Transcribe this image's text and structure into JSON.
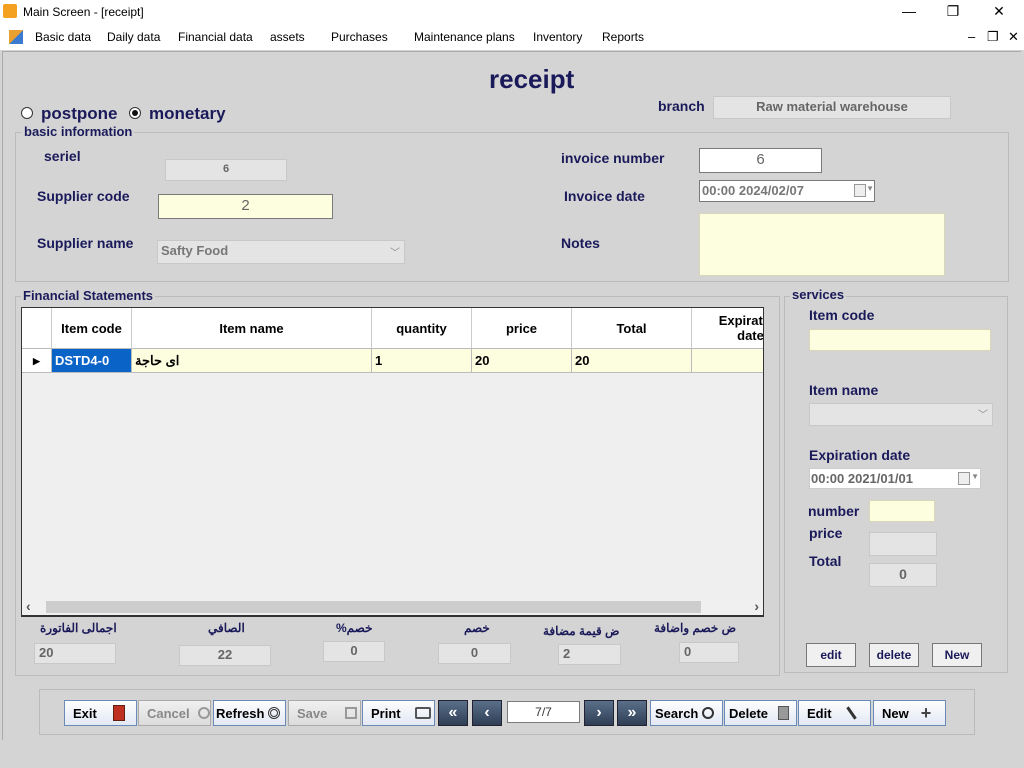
{
  "window": {
    "title": "Main Screen - [receipt]",
    "minimize": "—",
    "maximize": "❐",
    "close": "✕"
  },
  "menu": {
    "items": [
      "Basic data",
      "Daily data",
      "Financial data",
      "assets",
      "Purchases",
      "Maintenance plans",
      "Inventory",
      "Reports"
    ],
    "mdi_minimize": "–",
    "mdi_restore": "❐",
    "mdi_close": "✕"
  },
  "form": {
    "heading": "receipt",
    "payment_options": [
      "postpone",
      "monetary"
    ],
    "selected_payment": "monetary",
    "branch_label": "branch",
    "branch_value": "Raw material warehouse",
    "basic_info_title": "basic information",
    "serial_label": "seriel",
    "serial_value": "6",
    "supplier_code_label": "Supplier code",
    "supplier_code_value": "2",
    "supplier_name_label": "Supplier name",
    "supplier_name_value": "Safty Food",
    "invoice_number_label": "invoice number",
    "invoice_number_value": "6",
    "invoice_date_label": "Invoice date",
    "invoice_date_value": "00:00 2024/02/07",
    "notes_label": "Notes",
    "notes_value": ""
  },
  "grid": {
    "title": "Financial Statements",
    "columns": [
      "Item code",
      "Item name",
      "quantity",
      "price",
      "Total",
      "Expiration date"
    ],
    "rows": [
      {
        "item_code": "DSTD4-0",
        "item_name": "اى حاجة",
        "quantity": "1",
        "price": "20",
        "total": "20",
        "expiration": ""
      }
    ],
    "row_indicator": "▶",
    "scroll_left": "‹",
    "scroll_right": "›"
  },
  "services": {
    "title": "services",
    "item_code_label": "Item code",
    "item_code_value": "",
    "item_name_label": "Item name",
    "item_name_value": "",
    "expiration_label": "Expiration date",
    "expiration_value": "00:00 2021/01/01",
    "number_label": "number",
    "number_value": "",
    "price_label": "price",
    "price_value": "",
    "total_label": "Total",
    "total_value": "0",
    "edit_button": "edit",
    "delete_button": "delete",
    "new_button": "New"
  },
  "summary": {
    "invoice_total_label": "اجمالى الفاتورة",
    "invoice_total_value": "20",
    "net_label": "الصافي",
    "net_value": "22",
    "discount_pct_label": "%خصم",
    "discount_pct_value": "0",
    "discount_label": "خصم",
    "discount_value": "0",
    "vat_label": "ض قيمة مضافة",
    "vat_value": "2",
    "withholding_label": "ض خصم واضافة",
    "withholding_value": "0"
  },
  "toolbar": {
    "exit": "Exit",
    "cancel": "Cancel",
    "refresh": "Refresh",
    "save": "Save",
    "print": "Print",
    "first": "«",
    "prev": "‹",
    "record": "7/7",
    "next": "›",
    "last": "»",
    "search": "Search",
    "delete": "Delete",
    "edit": "Edit",
    "new": "New"
  }
}
